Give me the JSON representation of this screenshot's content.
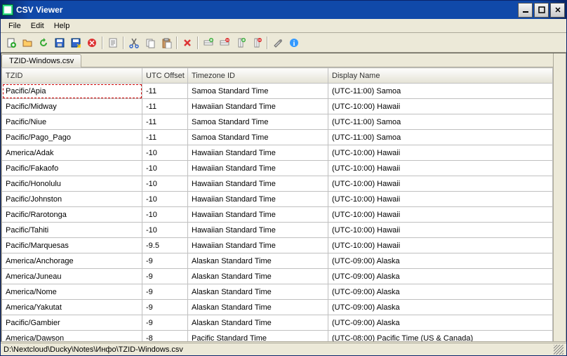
{
  "window": {
    "title": "CSV Viewer"
  },
  "menu": {
    "file": "File",
    "edit": "Edit",
    "help": "Help"
  },
  "tab": {
    "name": "TZID-Windows.csv"
  },
  "statusbar": {
    "path": "D:\\Nextcloud\\Ducky\\Notes\\Инфо\\TZID-Windows.csv"
  },
  "columns": [
    "TZID",
    "UTC Offset",
    "Timezone ID",
    "Display Name"
  ],
  "chart_data": {
    "type": "table",
    "columns": [
      "TZID",
      "UTC Offset",
      "Timezone ID",
      "Display Name"
    ],
    "rows": [
      [
        "Pacific/Apia",
        "-11",
        "Samoa Standard Time",
        "(UTC-11:00) Samoa"
      ],
      [
        "Pacific/Midway",
        "-11",
        "Hawaiian Standard Time",
        "(UTC-10:00) Hawaii"
      ],
      [
        "Pacific/Niue",
        "-11",
        "Samoa Standard Time",
        "(UTC-11:00) Samoa"
      ],
      [
        "Pacific/Pago_Pago",
        "-11",
        "Samoa Standard Time",
        "(UTC-11:00) Samoa"
      ],
      [
        "America/Adak",
        "-10",
        "Hawaiian Standard Time",
        "(UTC-10:00) Hawaii"
      ],
      [
        "Pacific/Fakaofo",
        "-10",
        "Hawaiian Standard Time",
        "(UTC-10:00) Hawaii"
      ],
      [
        "Pacific/Honolulu",
        "-10",
        "Hawaiian Standard Time",
        "(UTC-10:00) Hawaii"
      ],
      [
        "Pacific/Johnston",
        "-10",
        "Hawaiian Standard Time",
        "(UTC-10:00) Hawaii"
      ],
      [
        "Pacific/Rarotonga",
        "-10",
        "Hawaiian Standard Time",
        "(UTC-10:00) Hawaii"
      ],
      [
        "Pacific/Tahiti",
        "-10",
        "Hawaiian Standard Time",
        "(UTC-10:00) Hawaii"
      ],
      [
        "Pacific/Marquesas",
        "-9.5",
        "Hawaiian Standard Time",
        "(UTC-10:00) Hawaii"
      ],
      [
        "America/Anchorage",
        "-9",
        "Alaskan Standard Time",
        "(UTC-09:00) Alaska"
      ],
      [
        "America/Juneau",
        "-9",
        "Alaskan Standard Time",
        "(UTC-09:00) Alaska"
      ],
      [
        "America/Nome",
        "-9",
        "Alaskan Standard Time",
        "(UTC-09:00) Alaska"
      ],
      [
        "America/Yakutat",
        "-9",
        "Alaskan Standard Time",
        "(UTC-09:00) Alaska"
      ],
      [
        "Pacific/Gambier",
        "-9",
        "Alaskan Standard Time",
        "(UTC-09:00) Alaska"
      ],
      [
        "America/Dawson",
        "-8",
        "Pacific Standard Time",
        "(UTC-08:00) Pacific Time (US & Canada)"
      ]
    ]
  },
  "toolbar_icons": [
    "new-file-icon",
    "open-file-icon",
    "refresh-icon",
    "save-icon",
    "save-as-icon",
    "close-icon",
    "sep",
    "page-icon",
    "sep",
    "cut-icon",
    "copy-icon",
    "paste-icon",
    "sep",
    "delete-icon",
    "sep",
    "row-insert-icon",
    "row-delete-icon",
    "col-insert-icon",
    "col-delete-icon",
    "sep",
    "settings-icon",
    "info-icon"
  ]
}
